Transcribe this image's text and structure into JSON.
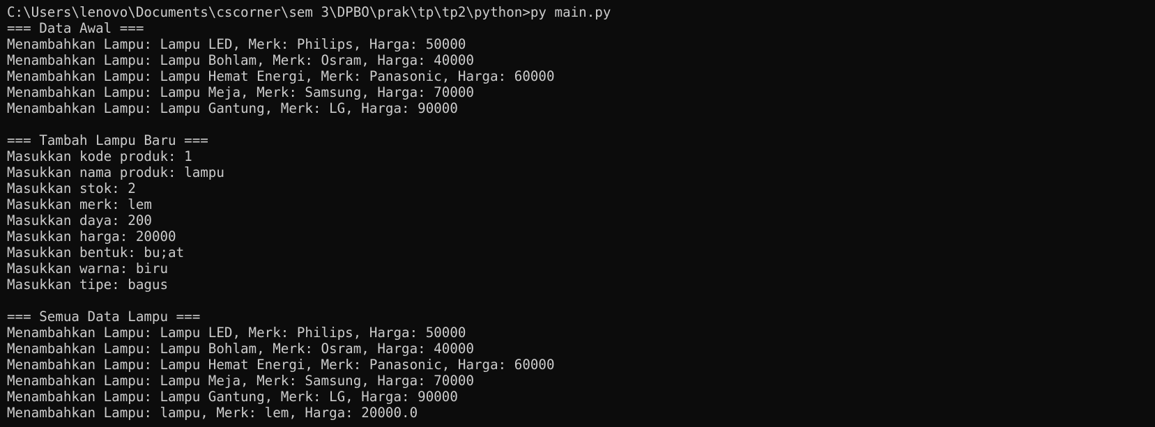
{
  "window": {
    "title": "Command Prompt"
  },
  "colors": {
    "background": "#0c0c0c",
    "foreground": "#cccccc"
  },
  "terminal": {
    "prompt": "C:\\Users\\lenovo\\Documents\\cscorner\\sem 3\\DPBO\\prak\\tp\\tp2\\python>",
    "command": "py main.py",
    "section_initial": {
      "header": "=== Data Awal ===",
      "lines": [
        "Menambahkan Lampu: Lampu LED, Merk: Philips, Harga: 50000",
        "Menambahkan Lampu: Lampu Bohlam, Merk: Osram, Harga: 40000",
        "Menambahkan Lampu: Lampu Hemat Energi, Merk: Panasonic, Harga: 60000",
        "Menambahkan Lampu: Lampu Meja, Merk: Samsung, Harga: 70000",
        "Menambahkan Lampu: Lampu Gantung, Merk: LG, Harga: 90000"
      ]
    },
    "section_add": {
      "header": "=== Tambah Lampu Baru ===",
      "prompts": [
        {
          "label": "Masukkan kode produk: ",
          "value": "1"
        },
        {
          "label": "Masukkan nama produk: ",
          "value": "lampu"
        },
        {
          "label": "Masukkan stok: ",
          "value": "2"
        },
        {
          "label": "Masukkan merk: ",
          "value": "lem"
        },
        {
          "label": "Masukkan daya: ",
          "value": "200"
        },
        {
          "label": "Masukkan harga: ",
          "value": "20000"
        },
        {
          "label": "Masukkan bentuk: ",
          "value": "bu;at"
        },
        {
          "label": "Masukkan warna: ",
          "value": "biru"
        },
        {
          "label": "Masukkan tipe: ",
          "value": "bagus"
        }
      ]
    },
    "section_all": {
      "header": "=== Semua Data Lampu ===",
      "lines": [
        "Menambahkan Lampu: Lampu LED, Merk: Philips, Harga: 50000",
        "Menambahkan Lampu: Lampu Bohlam, Merk: Osram, Harga: 40000",
        "Menambahkan Lampu: Lampu Hemat Energi, Merk: Panasonic, Harga: 60000",
        "Menambahkan Lampu: Lampu Meja, Merk: Samsung, Harga: 70000",
        "Menambahkan Lampu: Lampu Gantung, Merk: LG, Harga: 90000",
        "Menambahkan Lampu: lampu, Merk: lem, Harga: 20000.0"
      ]
    }
  }
}
